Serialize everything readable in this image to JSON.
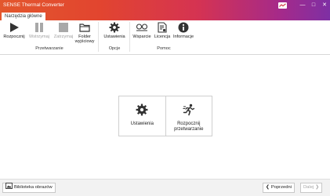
{
  "window": {
    "title": "SENSE Thermal Converter"
  },
  "tabs": {
    "main_label": "Narzędzia główne"
  },
  "ribbon": {
    "start_label": "Rozpocznij",
    "pause_label": "Wstrzymaj",
    "stop_label": "Zatrzymaj",
    "output_folder_label": "Folder wyjściowy",
    "settings_label": "Ustawienia",
    "support_label": "Wsparcie",
    "license_label": "Licencja",
    "info_label": "Informacje",
    "group_processing": "Przetwarzanie",
    "group_options": "Opcje",
    "group_help": "Pomoc"
  },
  "tiles": {
    "settings_label": "Ustawienia",
    "start_processing_label": "Rozpocznij przetwarzanie"
  },
  "statusbar": {
    "library_label": "Biblioteka obrazów",
    "prev_label": "Poprzedni",
    "next_label": "Dalej"
  },
  "colors": {
    "accent_start": "#e3572d",
    "accent_end": "#7e2fa4",
    "disabled": "#a0a0a0"
  },
  "icons": [
    "sense-logo",
    "play-icon",
    "pause-icon",
    "stop-icon",
    "folder-icon",
    "gear-icon",
    "support-icon",
    "license-icon",
    "info-icon",
    "run-icon",
    "gallery-icon",
    "chevron-left-icon",
    "chevron-right-icon"
  ]
}
